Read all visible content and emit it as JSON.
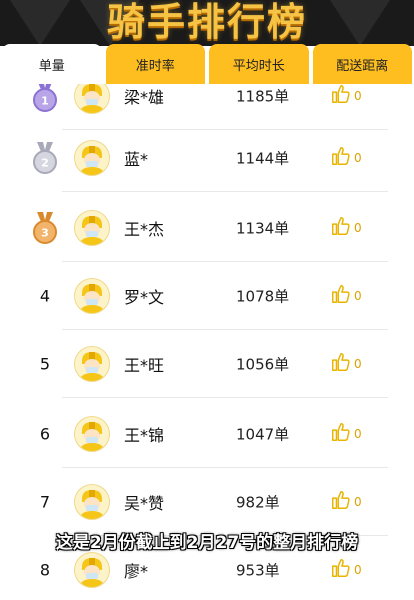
{
  "banner": {
    "title": "骑手排行榜"
  },
  "tabs": [
    {
      "label": "单量",
      "active": true
    },
    {
      "label": "准时率",
      "active": false
    },
    {
      "label": "平均时长",
      "active": false
    },
    {
      "label": "配送距离",
      "active": false
    }
  ],
  "rows": [
    {
      "rank": "1",
      "medal": "gold-medal-icon",
      "name": "梁*雄",
      "count": "1185单",
      "likes": "0"
    },
    {
      "rank": "2",
      "medal": "silver-medal-icon",
      "name": "蓝*",
      "count": "1144单",
      "likes": "0"
    },
    {
      "rank": "3",
      "medal": "bronze-medal-icon",
      "name": "王*杰",
      "count": "1134单",
      "likes": "0"
    },
    {
      "rank": "4",
      "name": "罗*文",
      "count": "1078单",
      "likes": "0"
    },
    {
      "rank": "5",
      "name": "王*旺",
      "count": "1056单",
      "likes": "0"
    },
    {
      "rank": "6",
      "name": "王*锦",
      "count": "1047单",
      "likes": "0"
    },
    {
      "rank": "7",
      "name": "吴*赞",
      "count": "982单",
      "likes": "0"
    },
    {
      "rank": "8",
      "name": "廖*",
      "count": "953单",
      "likes": "0"
    }
  ],
  "caption": "这是2月份截止到2月27号的整月排行榜",
  "colors": {
    "tab": "#ffbe1f",
    "banner_text": "#f6c344",
    "like": "#d9a400"
  }
}
